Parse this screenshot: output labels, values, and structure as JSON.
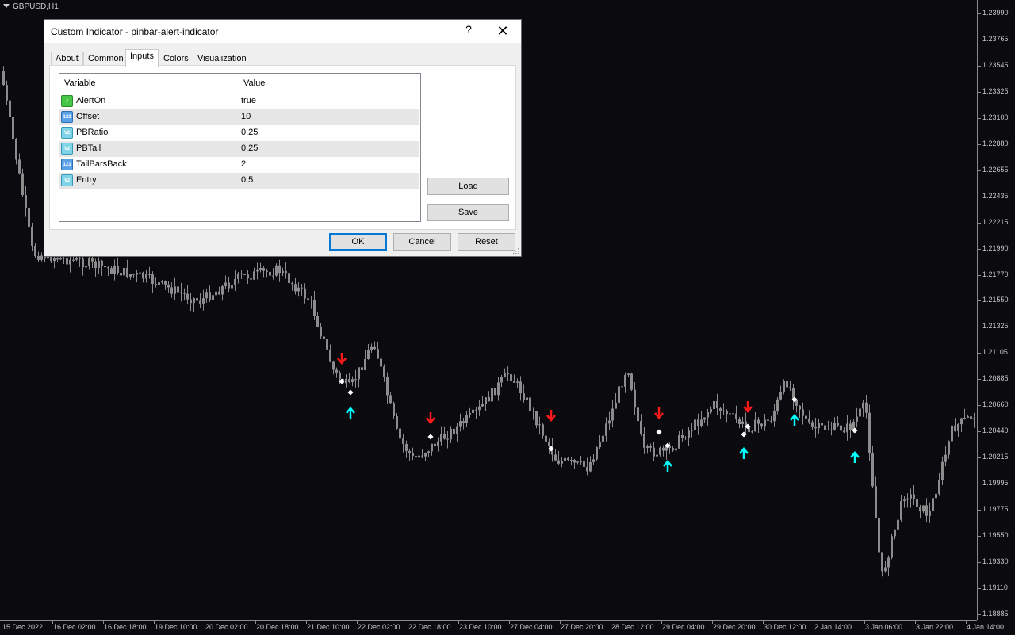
{
  "chart": {
    "symbol": "GBPUSD,H1",
    "price_labels": [
      "1.23990",
      "1.23765",
      "1.23545",
      "1.23325",
      "1.23100",
      "1.22880",
      "1.22655",
      "1.22435",
      "1.22215",
      "1.21990",
      "1.21770",
      "1.21550",
      "1.21325",
      "1.21105",
      "1.20885",
      "1.20660",
      "1.20440",
      "1.20215",
      "1.19995",
      "1.19775",
      "1.19550",
      "1.19330",
      "1.19110",
      "1.18885"
    ],
    "time_labels": [
      "15 Dec 2022",
      "16 Dec 02:00",
      "16 Dec 18:00",
      "19 Dec 10:00",
      "20 Dec 02:00",
      "20 Dec 18:00",
      "21 Dec 10:00",
      "22 Dec 02:00",
      "22 Dec 18:00",
      "23 Dec 10:00",
      "27 Dec 04:00",
      "27 Dec 20:00",
      "28 Dec 12:00",
      "29 Dec 04:00",
      "29 Dec 20:00",
      "30 Dec 12:00",
      "2 Jan 14:00",
      "3 Jan 06:00",
      "3 Jan 22:00",
      "4 Jan 14:00"
    ],
    "colors": {
      "background": "#0b0b0f",
      "candle": "#8c8c8c",
      "sell_arrow": "#ff1a1a",
      "buy_arrow": "#00ffff",
      "marker": "#ffffff"
    }
  },
  "dialog": {
    "title": "Custom Indicator - pinbar-alert-indicator",
    "help_label": "?",
    "close_label": "✕",
    "tabs": [
      {
        "label": "About"
      },
      {
        "label": "Common"
      },
      {
        "label": "Inputs",
        "active": true
      },
      {
        "label": "Colors"
      },
      {
        "label": "Visualization"
      }
    ],
    "columns": {
      "variable": "Variable",
      "value": "Value"
    },
    "params": [
      {
        "name": "AlertOn",
        "value": "true",
        "type": "bool",
        "icon": "bool-icon"
      },
      {
        "name": "Offset",
        "value": "10",
        "type": "int",
        "icon_text": "123",
        "icon": "int-icon"
      },
      {
        "name": "PBRatio",
        "value": "0.25",
        "type": "double",
        "icon_text": "V2",
        "icon": "double-icon"
      },
      {
        "name": "PBTail",
        "value": "0.25",
        "type": "double",
        "icon_text": "V2",
        "icon": "double-icon"
      },
      {
        "name": "TailBarsBack",
        "value": "2",
        "type": "int",
        "icon_text": "123",
        "icon": "int-icon"
      },
      {
        "name": "Entry",
        "value": "0.5",
        "type": "double",
        "icon_text": "V2",
        "icon": "double-icon"
      }
    ],
    "buttons": {
      "load": "Load",
      "save": "Save",
      "ok": "OK",
      "cancel": "Cancel",
      "reset": "Reset"
    }
  }
}
